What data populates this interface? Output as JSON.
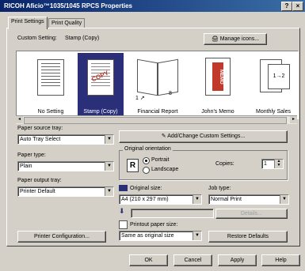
{
  "window": {
    "title": "RICOH Aficio™1035/1045 RPCS Properties"
  },
  "tabs": [
    {
      "label": "Print Settings"
    },
    {
      "label": "Print Quality"
    }
  ],
  "custom_setting": {
    "label": "Custom Setting:",
    "value": "Stamp (Copy)"
  },
  "buttons": {
    "manage_icons": "Manage icons...",
    "add_change_custom": "Add/Change Custom Settings...",
    "printer_configuration": "Printer Configuration...",
    "restore_defaults": "Restore Defaults",
    "details_disabled": "Details...",
    "ok": "OK",
    "cancel": "Cancel",
    "apply": "Apply",
    "help": "Help"
  },
  "thumbnails": [
    {
      "caption": "No Setting",
      "selected": false
    },
    {
      "caption": "Stamp (Copy)",
      "selected": true
    },
    {
      "caption": "Financial Report",
      "selected": false
    },
    {
      "caption": "John's Memo",
      "selected": false
    },
    {
      "caption": "Monthly Sales",
      "selected": false
    }
  ],
  "paper_source": {
    "label": "Paper source tray:",
    "value": "Auto Tray Select"
  },
  "paper_type": {
    "label": "Paper type:",
    "value": "Plain"
  },
  "paper_output": {
    "label": "Paper output tray:",
    "value": "Printer Default"
  },
  "orientation": {
    "group_label": "Original orientation",
    "portrait": "Portrait",
    "landscape": "Landscape",
    "selected": "Portrait"
  },
  "copies": {
    "label": "Copies:",
    "value": "1"
  },
  "original_size": {
    "label": "Original size:",
    "value": "A4 (210 x 297 mm)"
  },
  "job_type": {
    "label": "Job type:",
    "value": "Normal Print"
  },
  "printout_size": {
    "label": "Printout paper size:",
    "value": "Same as original size"
  },
  "colors": {
    "titlebar": "#0a246a",
    "selected_thumb": "#2b2f7a",
    "memo_red": "#c0392b"
  }
}
